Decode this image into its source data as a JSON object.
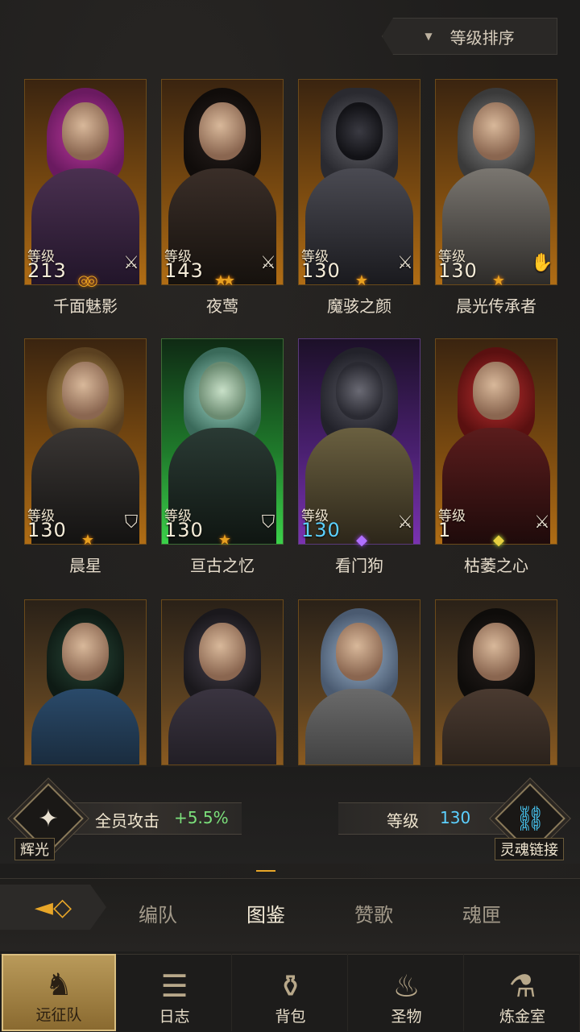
{
  "sort": {
    "label": "等级排序",
    "icon": "triangle-down-icon"
  },
  "heroes": [
    {
      "name": "千面魅影",
      "level_label": "等级",
      "level": "213",
      "class_icon": "sword-icon",
      "rarity": "orange"
    },
    {
      "name": "夜莺",
      "level_label": "等级",
      "level": "143",
      "class_icon": "sword-icon",
      "rarity": "orange"
    },
    {
      "name": "魔骇之颜",
      "level_label": "等级",
      "level": "130",
      "class_icon": "sword-icon",
      "rarity": "orange"
    },
    {
      "name": "晨光传承者",
      "level_label": "等级",
      "level": "130",
      "class_icon": "hand-icon",
      "rarity": "orange"
    },
    {
      "name": "晨星",
      "level_label": "等级",
      "level": "130",
      "class_icon": "shield-icon",
      "rarity": "orange"
    },
    {
      "name": "亘古之忆",
      "level_label": "等级",
      "level": "130",
      "class_icon": "shield-icon",
      "rarity": "green"
    },
    {
      "name": "看门狗",
      "level_label": "等级",
      "level": "130",
      "class_icon": "sword-icon",
      "rarity": "purple"
    },
    {
      "name": "枯萎之心",
      "level_label": "等级",
      "level": "1",
      "class_icon": "sword-icon",
      "rarity": "orange"
    }
  ],
  "bonus": {
    "emblem_label": "辉光",
    "text": "全员攻击",
    "value": "+5.5%",
    "level_label": "等级",
    "level_value": "130",
    "link_label": "灵魂链接"
  },
  "tabs": [
    "编队",
    "图鉴",
    "赞歌",
    "魂匣"
  ],
  "active_tab": "图鉴",
  "nav": [
    {
      "label": "远征队",
      "icon": "helmet-icon"
    },
    {
      "label": "日志",
      "icon": "scroll-icon"
    },
    {
      "label": "背包",
      "icon": "bag-icon"
    },
    {
      "label": "圣物",
      "icon": "torch-icon"
    },
    {
      "label": "炼金室",
      "icon": "alchemy-icon"
    }
  ],
  "colors": {
    "accent": "#e8a628",
    "level_blue": "#5cd0ff",
    "bonus_green": "#7be07b"
  }
}
